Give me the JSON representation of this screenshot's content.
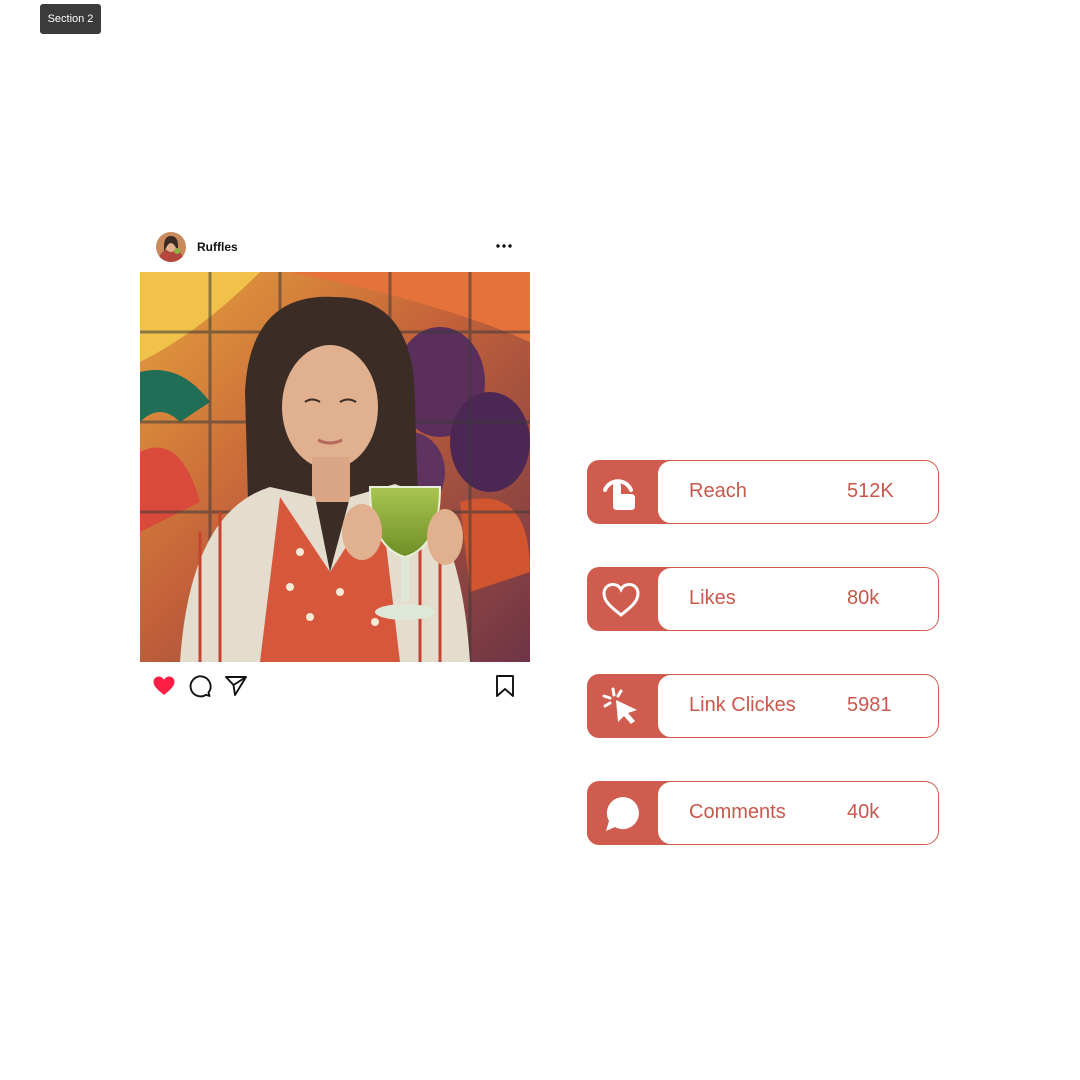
{
  "section_tag": "Section 2",
  "post": {
    "username": "Ruffles",
    "icons": {
      "avatar": "avatar-photo",
      "more": "more-horizontal-icon",
      "like": "heart-filled-icon",
      "comment": "comment-bubble-icon",
      "share": "paper-plane-icon",
      "save": "bookmark-icon"
    },
    "like_color": "#ff1f45"
  },
  "stats": [
    {
      "label": "Reach",
      "value": "512K",
      "icon": "tap-hand-icon"
    },
    {
      "label": "Likes",
      "value": "80k",
      "icon": "heart-outline-icon"
    },
    {
      "label": "Link Clickes",
      "value": "5981",
      "icon": "cursor-click-icon"
    },
    {
      "label": "Comments",
      "value": "40k",
      "icon": "chat-bubble-icon"
    }
  ],
  "colors": {
    "accent": "#d05c50",
    "accent_text": "#c9574b",
    "tag_bg": "#3b3b3b"
  }
}
